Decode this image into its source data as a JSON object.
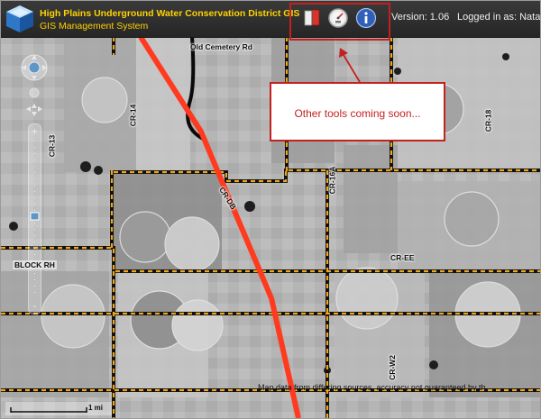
{
  "app": {
    "title_line1": "High Plains Underground Water Conservation District GIS",
    "title_line2": "GIS Management System",
    "version_text": "Version: 1.06",
    "login_text": "Logged in as: Nata"
  },
  "toolbar": {
    "tools": [
      {
        "name": "book-icon"
      },
      {
        "name": "gauge-icon"
      },
      {
        "name": "info-icon"
      }
    ]
  },
  "callout": {
    "text": "Other tools coming soon..."
  },
  "map": {
    "road_labels": {
      "old_cemetery": "Old Cemetery Rd",
      "cr14": "CR-14",
      "cr13": "CR-13",
      "cr18": "CR-18",
      "cr16a": "CR-16A",
      "crdb": "CR-DB",
      "cree": "CR-EE",
      "crw2": "CR-W2"
    },
    "block_label": "BLOCK RH",
    "disclaimer": "Map data from differing sources, accuracy not guaranteed by th",
    "scale_label": "1 mi"
  },
  "colors": {
    "title": "#ffd200",
    "callout_border": "#c42020",
    "highway": "#ff3a1e",
    "section_line_dash": "#f2a61c"
  }
}
